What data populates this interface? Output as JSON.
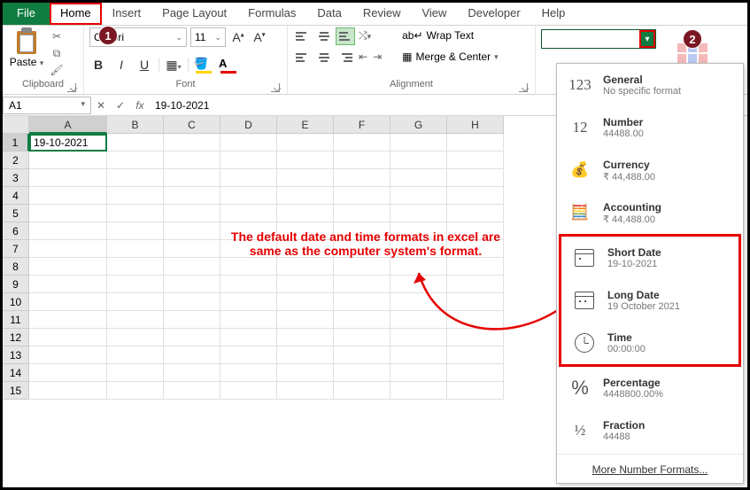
{
  "tabs": {
    "file": "File",
    "home": "Home",
    "insert": "Insert",
    "page_layout": "Page Layout",
    "formulas": "Formulas",
    "data": "Data",
    "review": "Review",
    "view": "View",
    "developer": "Developer",
    "help": "Help"
  },
  "clipboard": {
    "paste": "Paste",
    "label": "Clipboard"
  },
  "font": {
    "name": "Calibri",
    "size": "11",
    "label": "Font",
    "bold": "B",
    "italic": "I",
    "underline": "U"
  },
  "alignment": {
    "label": "Alignment",
    "wrap": "Wrap Text",
    "merge": "Merge & Center"
  },
  "namebox": "A1",
  "formula": "19-10-2021",
  "cellA1": "19-10-2021",
  "cols": [
    "A",
    "B",
    "C",
    "D",
    "E",
    "F",
    "G",
    "H"
  ],
  "rows": [
    "1",
    "2",
    "3",
    "4",
    "5",
    "6",
    "7",
    "8",
    "9",
    "10",
    "11",
    "12",
    "13",
    "14",
    "15"
  ],
  "annot_l1": "The default date and time formats in excel are",
  "annot_l2": "same as the computer system's format.",
  "dd": {
    "general": {
      "name": "General",
      "sample": "No specific format"
    },
    "number": {
      "name": "Number",
      "sample": "44488.00"
    },
    "currency": {
      "name": "Currency",
      "sample": "₹ 44,488.00"
    },
    "accounting": {
      "name": "Accounting",
      "sample": "₹ 44,488.00"
    },
    "shortdate": {
      "name": "Short Date",
      "sample": "19-10-2021"
    },
    "longdate": {
      "name": "Long Date",
      "sample": "19 October 2021"
    },
    "time": {
      "name": "Time",
      "sample": "00:00:00"
    },
    "percentage": {
      "name": "Percentage",
      "sample": "4448800.00%"
    },
    "fraction": {
      "name": "Fraction",
      "sample": "44488"
    },
    "more": "More Number Formats..."
  },
  "badges": {
    "one": "1",
    "two": "2"
  }
}
